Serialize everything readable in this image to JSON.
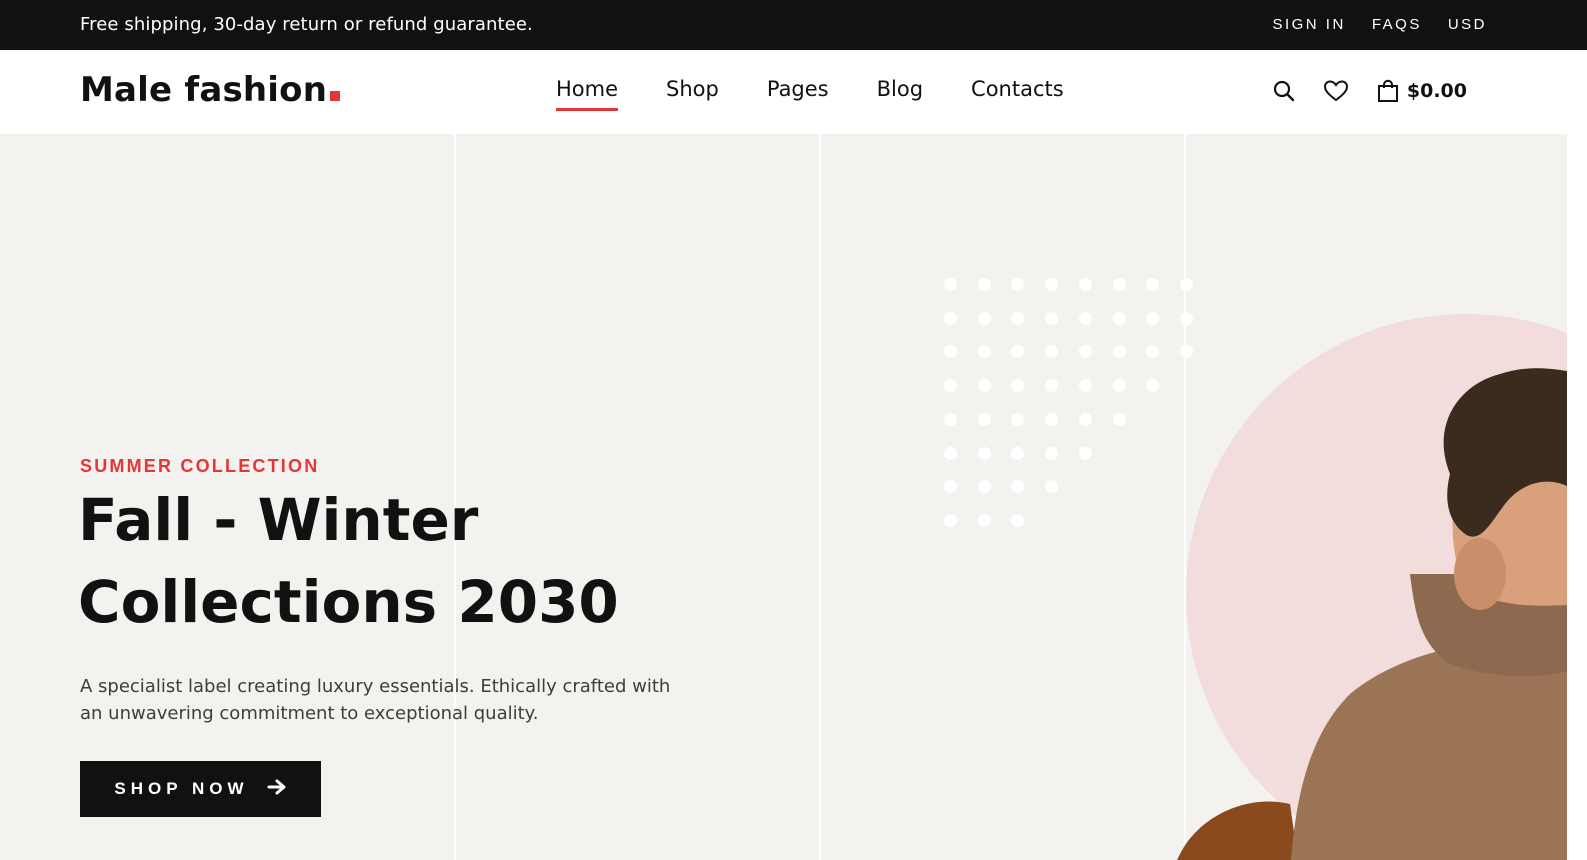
{
  "topbar": {
    "promo": "Free shipping, 30-day return or refund guarantee.",
    "links": [
      "SIGN IN",
      "FAQS",
      "USD"
    ]
  },
  "header": {
    "logo": "Male fashion",
    "nav": [
      "Home",
      "Shop",
      "Pages",
      "Blog",
      "Contacts"
    ],
    "active_nav": "Home",
    "cart_total": "$0.00",
    "icons": [
      "search-icon",
      "heart-icon",
      "shopping-bag-icon"
    ]
  },
  "hero": {
    "subtitle": "SUMMER COLLECTION",
    "title_line1": "Fall - Winter",
    "title_line2": "Collections 2030",
    "description": "A specialist label creating luxury essentials. Ethically crafted with an unwavering commitment to exceptional quality.",
    "cta_label": "SHOP NOW"
  },
  "colors": {
    "accent": "#e53637",
    "dark": "#111111",
    "hero_bg": "#f3f2ee",
    "circle": "#f2dcdc"
  }
}
